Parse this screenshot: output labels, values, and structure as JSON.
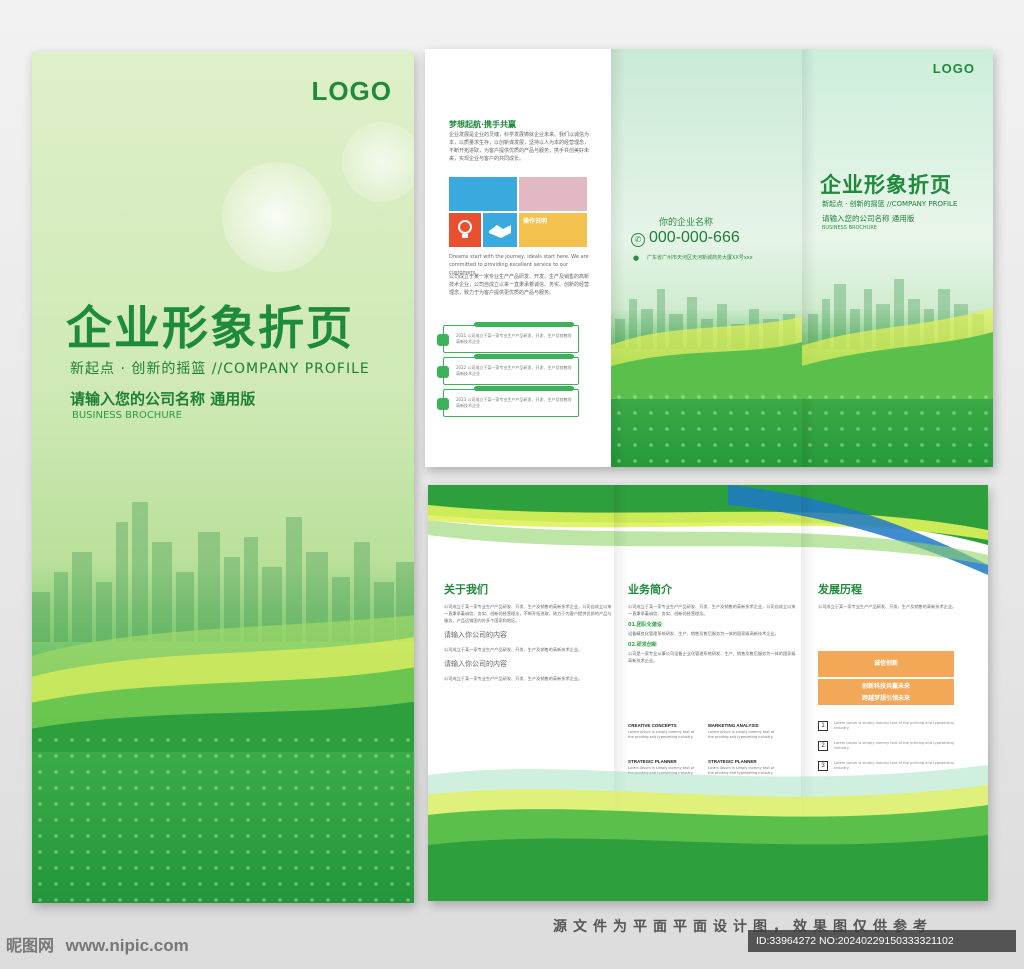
{
  "cover": {
    "logo": "LOGO",
    "title": "企业形象折页",
    "subtitle": "新起点 · 创新的摇篮 //COMPANY PROFILE",
    "company_name": "请输入您的公司名称   通用版",
    "business": "BUSINESS BROCHURE"
  },
  "inner_left": {
    "title": "梦想起航·携手共赢",
    "para1": "企业发展是企业的灵魂，科学发展铸就企业未来。我们以诚信为本，以质量求生存，以创新谋发展，坚持以人为本的经营理念，不断开拓进取，为客户提供优质的产品与服务，携手共创美好未来，实现企业与客户的共同成长。",
    "block_label": "操作说明",
    "para2": "Dreams start with the journey, ideals start here. We are committed to providing excellent service to our customers.",
    "para3": "公司成立于某一家专业生产产品研发、开发、生产及销售的高新技术企业，公司自成立以来一直秉承着诚信、务实、创新的经营理念，致力于为客户提供更优质的产品与服务。",
    "steps": [
      "2021 公司成立于某一家专业生产产品研发、开发、生产及销售的高新技术企业",
      "2022 公司成立于某一家专业生产产品研发、开发、生产及销售的高新技术企业",
      "2023 公司成立于某一家专业生产产品研发、开发、生产及销售的高新技术企业"
    ]
  },
  "back_page": {
    "company": "你的企业名称",
    "phone": "000-000-666",
    "address": "广东省广州市天河区天河新城商务大厦XX号xxx"
  },
  "front_page": {
    "logo": "LOGO",
    "title": "企业形象折页",
    "subtitle": "新起点 · 创新的摇篮 //COMPANY PROFILE",
    "company_name": "请输入您的公司名称   通用版",
    "business": "BUSINESS BROCHURE"
  },
  "about": {
    "heading": "关于我们",
    "para": "公司成立于某一家专业生产产品研发、开发、生产及销售的高新技术企业，公司自成立以来一直秉承着诚信、务实、创新的经营理念，不断开拓进取，致力于为客户提供优质的产品与服务，产品远销国内外多个国家和地区。",
    "sub1": "请输入你公司的内容",
    "para2": "公司成立于某一家专业生产产品研发、开发、生产及销售的高新技术企业。",
    "sub2": "请输入你公司的内容",
    "para3": "公司成立于某一家专业生产产品研发、开发、生产及销售的高新技术企业。"
  },
  "business": {
    "heading": "业务简介",
    "para": "公司成立于某一家专业生产产品研发、开发、生产及销售的高新技术企业，公司自成立以来一直秉承着诚信、务实、创新的经营理念。",
    "item1": "01.团队化建设",
    "item1_text": "设备精良化管理系统研发、生产、销售及售后服务为一体的国家级高新技术企业。",
    "item2": "02.研发创新",
    "item2_text": "公司是一家专业从事公司设备企业化管理系统研发、生产、销售及售后服务为一体的国家级高新技术企业。",
    "services": [
      {
        "title": "CREATIVE CONCEPTS",
        "desc": "Lorem Ipsum is simply dummy text of the printing and typesetting industry."
      },
      {
        "title": "MARKETING ANALYSIS",
        "desc": "Lorem Ipsum is simply dummy text of the printing and typesetting industry."
      },
      {
        "title": "STRATEGIC PLANNER",
        "desc": "Lorem Ipsum is simply dummy text of the printing and typesetting industry."
      },
      {
        "title": "STRATEGIC PLANNER",
        "desc": "Lorem Ipsum is simply dummy text of the printing and typesetting industry."
      }
    ]
  },
  "history": {
    "heading": "发展历程",
    "para": "公司成立于某一家专业生产产品研发、开发、生产及销售的高新技术企业。",
    "box1": "诚信创新",
    "box2": "创新科技共赢未来\n跨越梦想引领未来",
    "rows": [
      {
        "num": "1",
        "text": "Lorem Ipsum is simply dummy text of the printing and typesetting industry."
      },
      {
        "num": "2",
        "text": "Lorem Ipsum is simply dummy text of the printing and typesetting industry."
      },
      {
        "num": "3",
        "text": "Lorem Ipsum is simply dummy text of the printing and typesetting industry."
      }
    ]
  },
  "footer": {
    "note": "源文件为平面平面设计图，效果图仅供参考",
    "watermark": "昵图网",
    "url": "www.nipic.com",
    "id": "ID:33964272 NO:20240229150333321102"
  },
  "colors": {
    "brand_green": "#1f8a3b",
    "accent_orange": "#f2a857"
  }
}
